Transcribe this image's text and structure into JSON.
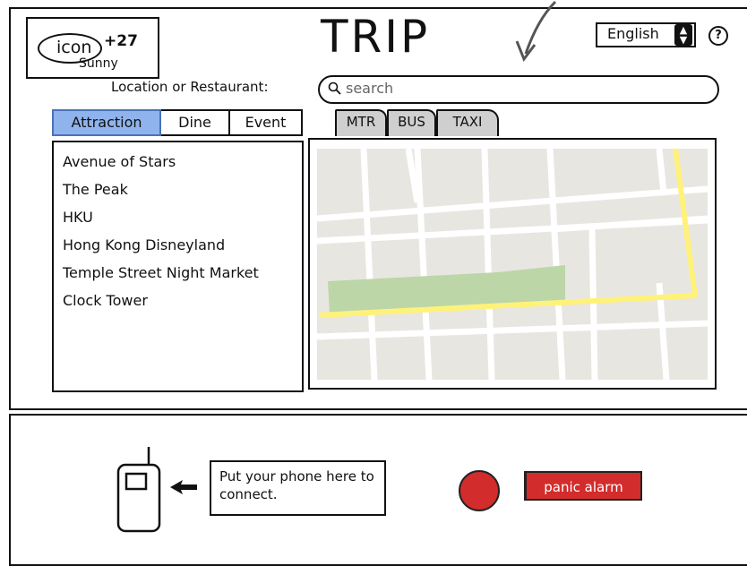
{
  "header": {
    "title": "TRIP",
    "weather": {
      "icon_label": "icon",
      "temperature": "+27",
      "condition": "Sunny"
    },
    "language": {
      "selected": "English"
    }
  },
  "search": {
    "label": "Location or Restaurant:",
    "placeholder": "search"
  },
  "category_tabs": [
    {
      "label": "Attraction",
      "selected": true
    },
    {
      "label": "Dine",
      "selected": false
    },
    {
      "label": "Event",
      "selected": false
    }
  ],
  "transport_tabs": [
    {
      "label": "MTR"
    },
    {
      "label": "BUS"
    },
    {
      "label": "TAXI"
    }
  ],
  "attractions": [
    "Avenue of Stars",
    "The Peak",
    "HKU",
    "Hong Kong Disneyland",
    "Temple Street Night Market",
    "Clock Tower"
  ],
  "phone": {
    "instruction": "Put your phone here to connect."
  },
  "alarm": {
    "label": "panic alarm"
  },
  "colors": {
    "selected_tab": "#8fb3ec",
    "alarm_red": "#d32c2c",
    "map_road_yellow": "#fff27a",
    "map_park_green": "#bcd6a8",
    "map_block": "#e8e6e1"
  }
}
